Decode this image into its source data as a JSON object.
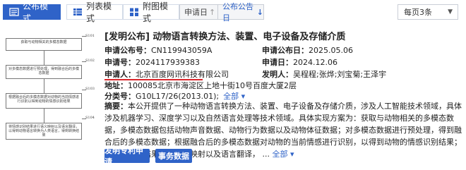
{
  "toolbar": {
    "modes": [
      {
        "label": "公布模式",
        "icon": "list-icon",
        "active": true
      },
      {
        "label": "列表模式",
        "icon": "table-icon",
        "active": false
      },
      {
        "label": "附图模式",
        "icon": "grid-icon",
        "active": false
      }
    ],
    "sorts": [
      {
        "label": "申请日",
        "arrow": "↑"
      },
      {
        "label": "公布公告日",
        "arrow": "↓"
      }
    ],
    "page_size": "每页3条"
  },
  "figure": {
    "boxes": [
      {
        "text": "获取与动物相关的多模态数据",
        "num": "S101"
      },
      {
        "text": "对多模态数据进行预处理，得到融合后的多模态数据",
        "num": "S102"
      },
      {
        "text": "根据融合后的多模态数据对动物的当前情感进行识别以得到动物的情感识别结果",
        "num": "S103"
      },
      {
        "text": "将情感识别结果进行语义映射以及语言翻译，以得到动物语言转换为人类语言，得到转换结果",
        "num": "S104"
      }
    ]
  },
  "record": {
    "title": "[发明公布] 动物语言转换方法、装置、电子设备及存储介质",
    "app_no_label": "申请公布号：",
    "app_no": "CN119943059A",
    "pub_date_label": "申请公布日：",
    "pub_date": "2025.05.06",
    "filing_no_label": "申请号：",
    "filing_no": "2024117939383",
    "filing_date_label": "申请日：",
    "filing_date": "2024.12.06",
    "applicant_label": "申请人：",
    "applicant": "北京百度网讯科技有限公司",
    "inventor_label": "发明人：",
    "inventor": "吴程程;张烨;刘宝菊;王泽宇",
    "address_label": "地址：",
    "address": "100085北京市海淀区上地十街10号百度大厦2层",
    "class_label": "分类号：",
    "class_value": "G10L17/26(2013.01);",
    "class_all": "全部",
    "abstract_label": "摘要：",
    "abstract_text": "本公开提供了一种动物语言转换方法、装置、电子设备及存储介质，涉及人工智能技术领域，具体涉及机器学习、深度学习以及自然语言处理等技术领域。具体实现方案为：获取与动物相关的多模态数据，多模态数据包括动物声音数据、动物行为数据以及动物体征数据；对多模态数据进行预处理，得到融合后的多模态数据；根据融合后的多模态数据对动物的当前情感进行识别，以得到动物的情感识别结果；将情感识别结果进行语义映射以及语言翻译，",
    "abstract_more": "全部"
  },
  "buttons": {
    "publish_label": "发明专利申请",
    "affairs_label": "事务数据"
  },
  "colors": {
    "accent": "#2f63c8",
    "underline": "#d9262b"
  }
}
